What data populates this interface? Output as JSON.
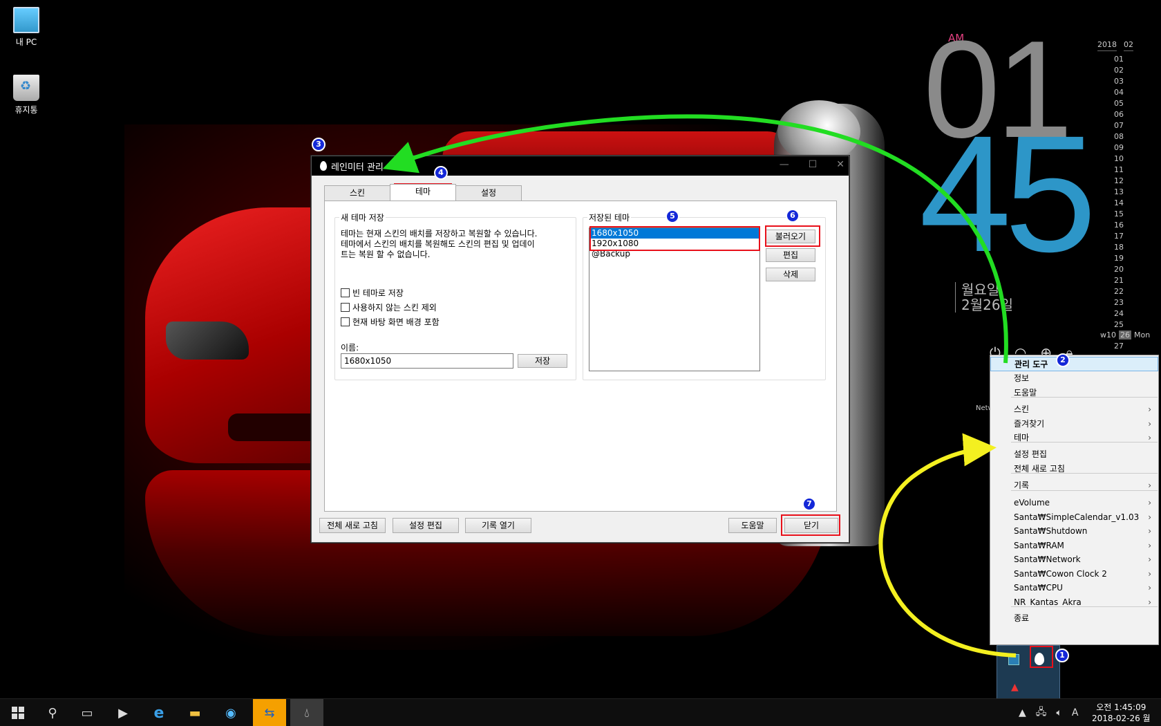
{
  "desktop": {
    "icons": [
      {
        "label": "내 PC",
        "icon": "pc-icon"
      },
      {
        "label": "휴지통",
        "icon": "recycle-bin-icon"
      }
    ]
  },
  "clock_widget": {
    "ampm": "AM",
    "hour": "01",
    "minute": "45",
    "weekday": "월요일",
    "date": "2월26일"
  },
  "calendar_widget": {
    "year": "2018",
    "month": "02",
    "days": [
      "01",
      "02",
      "03",
      "04",
      "05",
      "06",
      "07",
      "08",
      "09",
      "10",
      "11",
      "12",
      "13",
      "14",
      "15",
      "16",
      "17",
      "18",
      "19",
      "20",
      "21",
      "22",
      "23",
      "24",
      "25"
    ],
    "week_label": "w10",
    "today": "26",
    "today_weekday": "Mon",
    "next_day": "27"
  },
  "network_label": "Netw",
  "dialog": {
    "title": "레인미터 관리",
    "tabs": [
      "스킨",
      "테마",
      "설정"
    ],
    "active_tab": "테마",
    "new_theme_group": {
      "label": "새 테마 저장",
      "description_lines": [
        "테마는 현재 스킨의 배치를 저장하고 복원할 수 있습니다.",
        "테마에서 스킨의 배치를 복원해도 스킨의 편집 및 업데이",
        "트는 복원 할 수 없습니다."
      ],
      "checkboxes": [
        {
          "label": "빈 테마로 저장",
          "checked": false
        },
        {
          "label": "사용하지 않는 스킨 제외",
          "checked": false
        },
        {
          "label": "현재 바탕 화면 배경 포함",
          "checked": false
        }
      ],
      "name_label": "이름:",
      "name_value": "1680x1050",
      "save_button": "저장"
    },
    "saved_themes_group": {
      "label": "저장된 테마",
      "themes": [
        {
          "name": "1680x1050",
          "selected": true
        },
        {
          "name": "1920x1080",
          "selected": false
        },
        {
          "name": "@Backup",
          "selected": false
        }
      ],
      "load_button": "불러오기",
      "edit_button": "편집",
      "delete_button": "삭제"
    },
    "footer": {
      "refresh_all": "전체 새로 고침",
      "edit_settings": "설정 편집",
      "open_log": "기록 열기",
      "help": "도움말",
      "close": "닫기"
    }
  },
  "context_menu": {
    "items": [
      {
        "label": "관리 도구",
        "submenu": false,
        "highlighted": true
      },
      {
        "label": "정보",
        "submenu": false
      },
      {
        "label": "도움말",
        "submenu": false
      },
      {
        "label": "스킨",
        "submenu": true
      },
      {
        "label": "즐겨찾기",
        "submenu": true
      },
      {
        "label": "테마",
        "submenu": true
      },
      {
        "label": "설정 편집",
        "submenu": false
      },
      {
        "label": "전체 새로 고침",
        "submenu": false
      },
      {
        "label": "기록",
        "submenu": true
      },
      {
        "label": "eVolume",
        "submenu": true
      },
      {
        "label": "Santa₩SimpleCalendar_v1.03",
        "submenu": true
      },
      {
        "label": "Santa₩Shutdown",
        "submenu": true
      },
      {
        "label": "Santa₩RAM",
        "submenu": true
      },
      {
        "label": "Santa₩Network",
        "submenu": true
      },
      {
        "label": "Santa₩Cowon Clock 2",
        "submenu": true
      },
      {
        "label": "Santa₩CPU",
        "submenu": true
      },
      {
        "label": "NR_Kantas_Akra",
        "submenu": true
      },
      {
        "label": "종료",
        "submenu": false
      }
    ],
    "arrow_glyph": "›"
  },
  "annotations": [
    "1",
    "2",
    "3",
    "4",
    "5",
    "6",
    "7"
  ],
  "annotation_colors": {
    "badge": "#1428d8",
    "box": "#e8101a",
    "green_arrow": "#22dd22",
    "yellow_arrow": "#f4f020"
  },
  "taskbar": {
    "pinned": [
      "start-icon",
      "search-icon",
      "task-view-icon",
      "media-player-icon",
      "internet-explorer-icon",
      "file-explorer-icon",
      "media-center-icon",
      "teamviewer-icon",
      "rainmeter-icon"
    ],
    "ime": "A",
    "time": "오전 1:45:09",
    "date": "2018-02-26 월"
  }
}
